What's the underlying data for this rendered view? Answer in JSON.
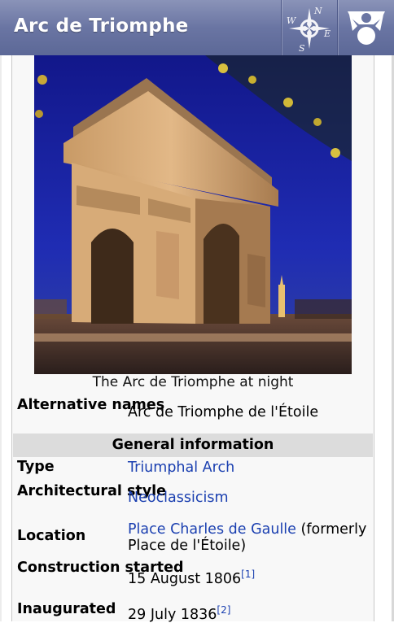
{
  "header": {
    "title": "Arc de Triomphe",
    "compass_letters": {
      "n": "N",
      "e": "E",
      "s": "S",
      "w": "W"
    }
  },
  "infobox": {
    "caption": "The Arc de Triomphe at night",
    "alternative_names_label": "Alternative names",
    "alternative_names_value": "Arc de Triomphe de l'Étoile",
    "section_title": "General information",
    "type_label": "Type",
    "type_value": "Triumphal Arch",
    "style_label": "Architectural style",
    "style_value": "Neoclassicism",
    "location_label": "Location",
    "location_link": "Place Charles de Gaulle",
    "location_rest": "(formerly Place de l'Étoile)",
    "construction_label": "Construction started",
    "construction_value": "15 August 1806",
    "construction_ref": "[1]",
    "inaugurated_label": "Inaugurated",
    "inaugurated_value": "29 July 1836",
    "inaugurated_ref": "[2]"
  },
  "colors": {
    "titlebar": "#6a75a3",
    "link": "#1a3fb0",
    "section_header_bg": "#dcdcdc",
    "infobox_bg": "#f8f8f8"
  },
  "icons": {
    "compass": "compass-icon",
    "menu": "wikipedia-menu-icon"
  }
}
